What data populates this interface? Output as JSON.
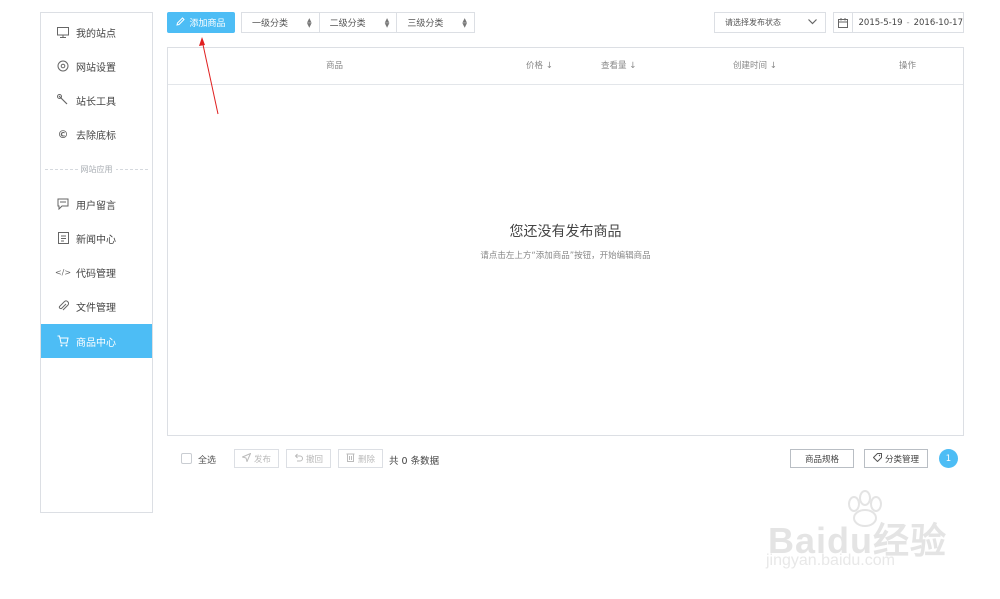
{
  "sidebar": {
    "items": [
      {
        "label": "我的站点",
        "icon": "monitor-icon"
      },
      {
        "label": "网站设置",
        "icon": "settings-icon"
      },
      {
        "label": "站长工具",
        "icon": "wrench-icon"
      },
      {
        "label": "去除底标",
        "icon": "copyright-icon"
      },
      {
        "label": "用户留言",
        "icon": "message-icon"
      },
      {
        "label": "新闻中心",
        "icon": "document-icon"
      },
      {
        "label": "代码管理",
        "icon": "code-icon"
      },
      {
        "label": "文件管理",
        "icon": "paperclip-icon"
      },
      {
        "label": "商品中心",
        "icon": "cart-icon"
      }
    ],
    "divider_label": "网站应用",
    "active_index": 8
  },
  "toolbar": {
    "add_button": "添加商品",
    "categories": [
      "一级分类",
      "二级分类",
      "三级分类"
    ],
    "status_placeholder": "请选择发布状态",
    "date_start": "2015-5-19",
    "date_separator": "-",
    "date_end": "2016-10-17"
  },
  "table": {
    "columns": {
      "product": "商品",
      "price": "价格",
      "views": "查看量",
      "created": "创建时间",
      "actions": "操作"
    },
    "empty_title": "您还没有发布商品",
    "empty_hint": "请点击左上方“添加商品”按钮，开始编辑商品"
  },
  "footer": {
    "select_all": "全选",
    "publish": "发布",
    "revoke": "撤回",
    "delete": "删除",
    "count_text": "共 0 条数据",
    "spec_button": "商品规格",
    "category_button": "分类管理",
    "current_page": "1"
  },
  "watermark": {
    "brand": "Baidu经验",
    "url": "jingyan.baidu.com"
  },
  "colors": {
    "accent": "#4dbdf5",
    "annotation_arrow": "#e02020"
  }
}
